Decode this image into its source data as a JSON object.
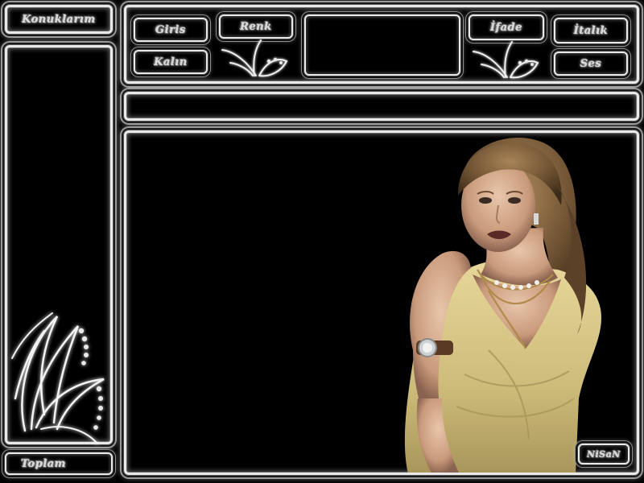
{
  "sidebar": {
    "title": "Konuklarım",
    "total_label": "Toplam"
  },
  "toolbar": {
    "login_label": "Giris",
    "bold_label": "Kalın",
    "color_label": "Renk",
    "emote_label": "İfade",
    "italic_label": "İtalık",
    "sound_label": "Ses"
  },
  "chat": {
    "signature": "NiSaN"
  },
  "colors": {
    "background": "#000000",
    "frame": "#e9e9e9",
    "label": "#d8d8d8"
  },
  "icons": {
    "sidebar_ornament": "swirl-flourish-icon",
    "toolbar_ornament": "swirl-flourish-icon"
  }
}
